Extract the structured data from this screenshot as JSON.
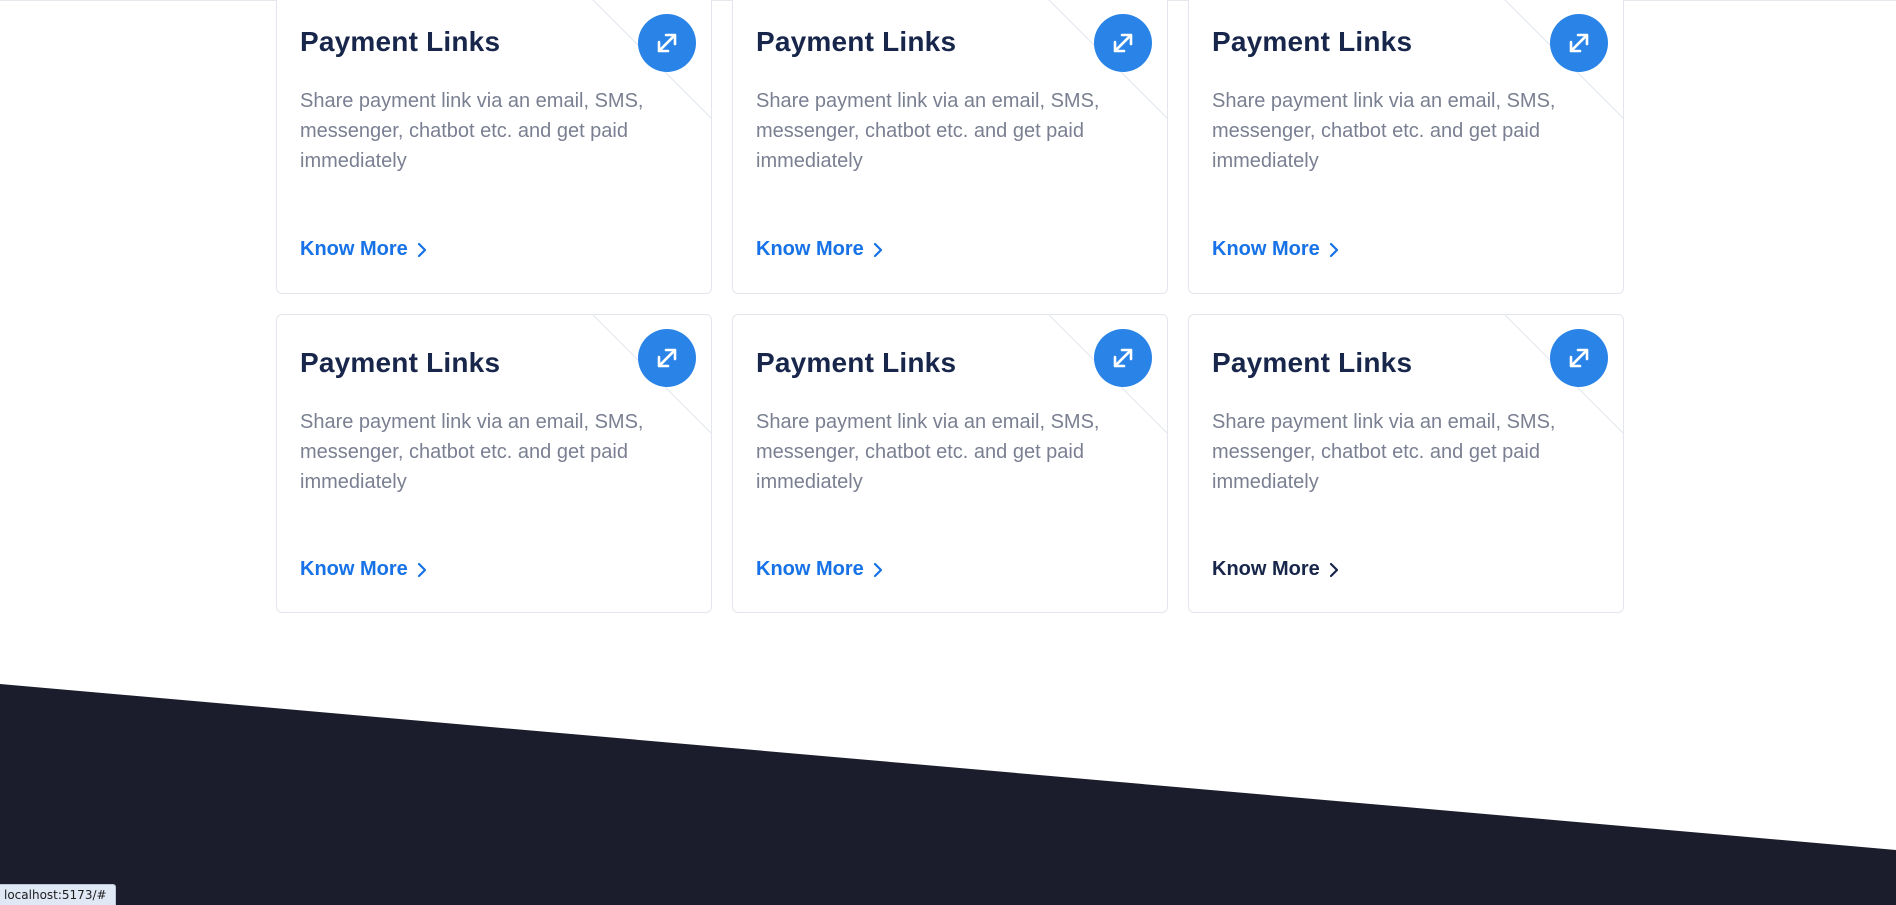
{
  "colors": {
    "accent": "#2a84e8",
    "link": "#1672e6",
    "title": "#17264a",
    "body_text": "#7a8092",
    "footer": "#1b1d2c"
  },
  "cards": [
    {
      "title": "Payment Links",
      "description": "Share payment link via an email, SMS, messenger, chatbot etc. and get paid immediately",
      "link_label": "Know More",
      "icon": "exchange-arrows-icon"
    },
    {
      "title": "Payment Links",
      "description": "Share payment link via an email, SMS, messenger, chatbot etc. and get paid immediately",
      "link_label": "Know More",
      "icon": "exchange-arrows-icon"
    },
    {
      "title": "Payment Links",
      "description": "Share payment link via an email, SMS, messenger, chatbot etc. and get paid immediately",
      "link_label": "Know More",
      "icon": "exchange-arrows-icon"
    },
    {
      "title": "Payment Links",
      "description": "Share payment link via an email, SMS, messenger, chatbot etc. and get paid immediately",
      "link_label": "Know More",
      "icon": "exchange-arrows-icon"
    },
    {
      "title": "Payment Links",
      "description": "Share payment link via an email, SMS, messenger, chatbot etc. and get paid immediately",
      "link_label": "Know More",
      "icon": "exchange-arrows-icon"
    },
    {
      "title": "Payment Links",
      "description": "Share payment link via an email, SMS, messenger, chatbot etc. and get paid immediately",
      "link_label": "Know More",
      "icon": "exchange-arrows-icon"
    }
  ],
  "status_bar": {
    "url": "localhost:5173/#"
  }
}
